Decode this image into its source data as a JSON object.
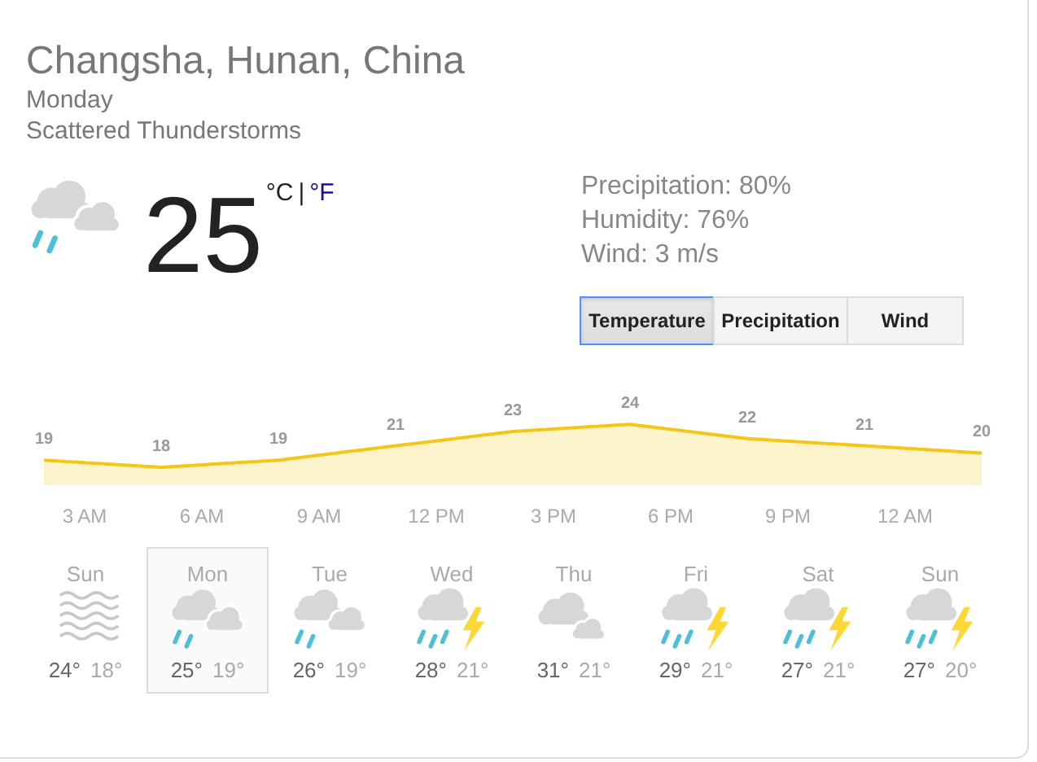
{
  "location": "Changsha, Hunan, China",
  "day": "Monday",
  "condition": "Scattered Thunderstorms",
  "current": {
    "kind": "rain",
    "temperature": "25",
    "units": [
      {
        "label": "°C",
        "selected": true
      },
      {
        "label": "°F",
        "selected": false
      }
    ],
    "separator": "|"
  },
  "details": [
    "Precipitation: 80%",
    "Humidity: 76%",
    "Wind: 3 m/s"
  ],
  "tabs": [
    {
      "label": "Temperature",
      "selected": true
    },
    {
      "label": "Precipitation",
      "selected": false
    },
    {
      "label": "Wind",
      "selected": false
    }
  ],
  "chart_data": {
    "type": "area",
    "categories": [
      null,
      null,
      null,
      null,
      null,
      null,
      null,
      null,
      null
    ],
    "series": [
      {
        "color": "#f5c518",
        "values": [
          19,
          18,
          19,
          21,
          23,
          24,
          22,
          21,
          20
        ]
      }
    ],
    "data_labels": true
  },
  "time_labels": [
    "3 AM",
    "6 AM",
    "9 AM",
    "12 PM",
    "3 PM",
    "6 PM",
    "9 PM",
    "12 AM"
  ],
  "forecast": [
    {
      "day": "Sun",
      "kind": "fog",
      "high": "24°",
      "low": "18°",
      "selected": false
    },
    {
      "day": "Mon",
      "kind": "rain",
      "high": "25°",
      "low": "19°",
      "selected": true
    },
    {
      "day": "Tue",
      "kind": "rain",
      "high": "26°",
      "low": "19°",
      "selected": false
    },
    {
      "day": "Wed",
      "kind": "storm",
      "high": "28°",
      "low": "21°",
      "selected": false
    },
    {
      "day": "Thu",
      "kind": "cloudy",
      "high": "31°",
      "low": "21°",
      "selected": false
    },
    {
      "day": "Fri",
      "kind": "storm",
      "high": "29°",
      "low": "21°",
      "selected": false
    },
    {
      "day": "Sat",
      "kind": "storm",
      "high": "27°",
      "low": "21°",
      "selected": false
    },
    {
      "day": "Sun",
      "kind": "storm",
      "high": "27°",
      "low": "20°",
      "selected": false
    }
  ]
}
